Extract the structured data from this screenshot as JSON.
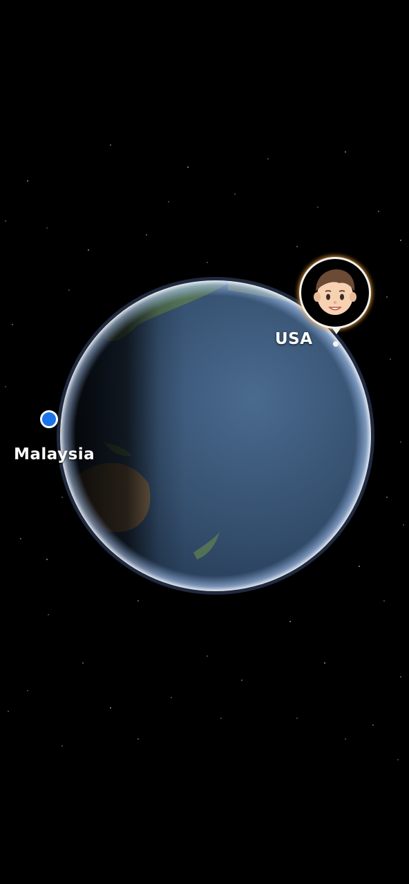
{
  "map": {
    "view": "globe",
    "markers": [
      {
        "label": "Malaysia",
        "marker_type": "current-location-dot",
        "color": "#1a73e8"
      },
      {
        "label": "USA",
        "marker_type": "avatar-pin",
        "avatar": "boy-emoji"
      }
    ]
  },
  "colors": {
    "background": "#000000",
    "ocean": "#3a5576",
    "location_dot": "#1a73e8",
    "label_text": "#ffffff"
  }
}
